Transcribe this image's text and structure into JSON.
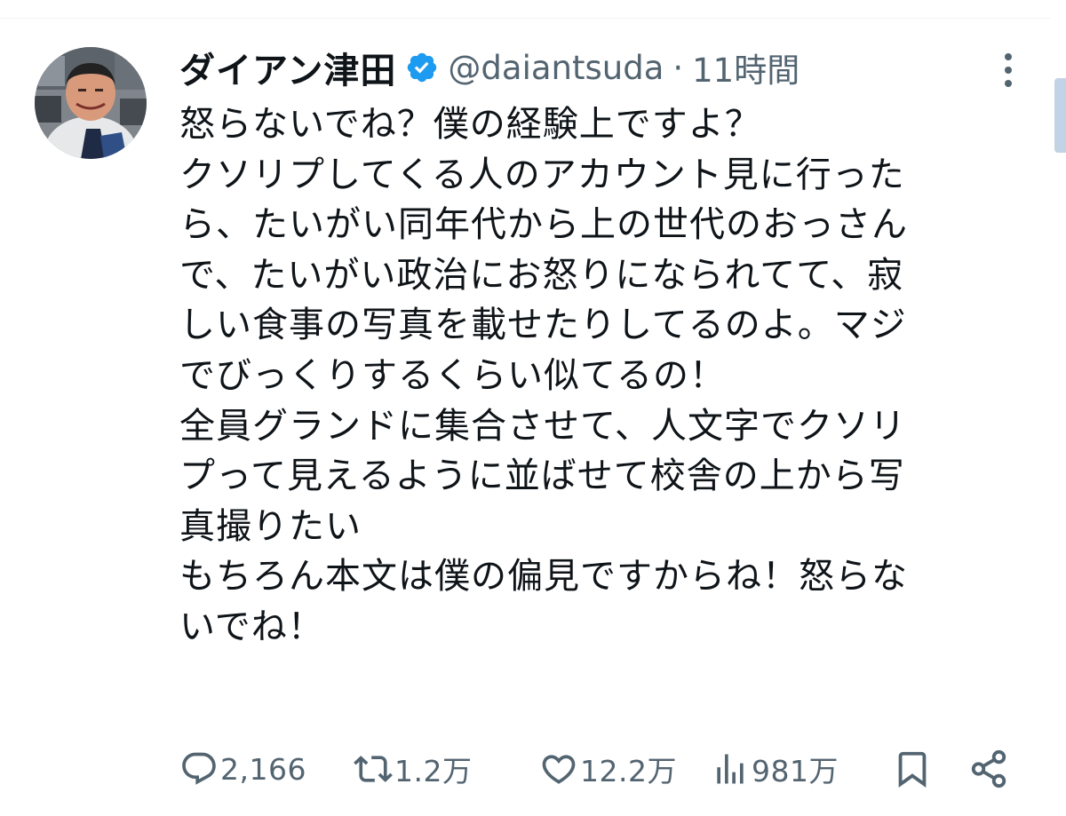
{
  "tweet": {
    "author": {
      "display_name": "ダイアン津田",
      "handle": "@daiantsuda",
      "verified": true,
      "avatar_icon": "profile-photo"
    },
    "separator": "·",
    "timestamp": "11時間",
    "body_lines": [
      "怒らないでね？僕の経験上ですよ？",
      "クソリプしてくる人のアカウント見に行った",
      "ら、たいがい同年代から上の世代のおっさん",
      "で、たいがい政治にお怒りになられてて、寂",
      "しい食事の写真を載せたりしてるのよ。マジ",
      "でびっくりするくらい似てるの！",
      "全員グランドに集合させて、人文字でクソリ",
      "プって見えるように並ばせて校舎の上から写",
      "真撮りたい",
      "もちろん本文は僕の偏見ですからね！怒らな",
      "いでね！"
    ],
    "actions": {
      "reply": {
        "icon": "reply-icon",
        "count": "2,166"
      },
      "retweet": {
        "icon": "retweet-icon",
        "count": "1.2万"
      },
      "like": {
        "icon": "heart-icon",
        "count": "12.2万"
      },
      "views": {
        "icon": "views-icon",
        "count": "981万"
      },
      "bookmark": {
        "icon": "bookmark-icon"
      },
      "share": {
        "icon": "share-icon"
      }
    }
  },
  "colors": {
    "text": "#0f1419",
    "secondary": "#536471",
    "verified": "#1d9bf0",
    "divider": "#eff3f4",
    "scrollbar": "#c2d3e6"
  }
}
